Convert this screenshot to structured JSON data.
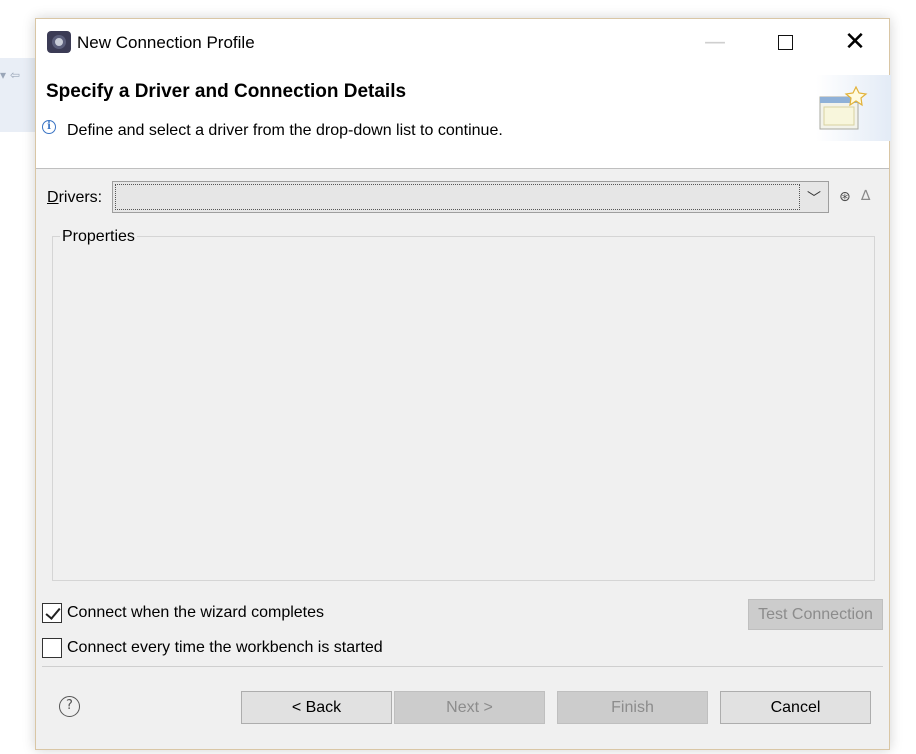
{
  "window": {
    "title": "New Connection Profile"
  },
  "header": {
    "title": "Specify a Driver and Connection Details",
    "message": "Define and select a driver from the drop-down list to continue."
  },
  "drivers": {
    "label": "Drivers:",
    "selected_value": ""
  },
  "properties": {
    "label": "Properties"
  },
  "options": {
    "connect_on_complete": {
      "label": "Connect when the wizard completes",
      "checked": true
    },
    "connect_on_startup": {
      "label": "Connect every time the workbench is started",
      "checked": false
    }
  },
  "buttons": {
    "test_connection": "Test Connection",
    "back": "< Back",
    "next": "Next >",
    "finish": "Finish",
    "cancel": "Cancel"
  },
  "icons": {
    "app": "eclipse-icon",
    "info": "info-icon",
    "banner": "wizard-banner-icon",
    "new_driver": "new-driver-icon",
    "edit_driver": "edit-driver-icon",
    "help": "help-icon"
  },
  "colors": {
    "dialog_bg": "#f0f0f0",
    "header_bg": "#ffffff",
    "disabled_button_bg": "#cccccc",
    "info_blue": "#3a74c4"
  }
}
